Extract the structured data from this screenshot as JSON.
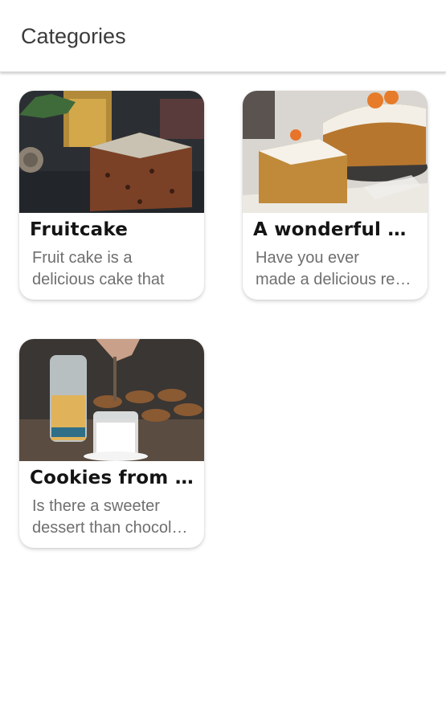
{
  "header": {
    "title": "Categories"
  },
  "cards": [
    {
      "title": "Fruitcake",
      "desc_line1": "Fruit cake is a",
      "desc_line2": "delicious cake that",
      "image": "fruitcake-slice-photo"
    },
    {
      "title": "A wonderful piece",
      "desc_line1": "Have you ever",
      "desc_line2": "made a delicious recipe",
      "image": "carrot-cake-photo"
    },
    {
      "title": "Cookies from chocolate",
      "desc_line1": "Is there a sweeter",
      "desc_line2": "dessert than chocolate",
      "image": "cookies-and-milk-photo"
    }
  ],
  "colors": {
    "title_text": "#141414",
    "desc_text": "#6f6f6f",
    "header_text": "#3b3b3b"
  }
}
